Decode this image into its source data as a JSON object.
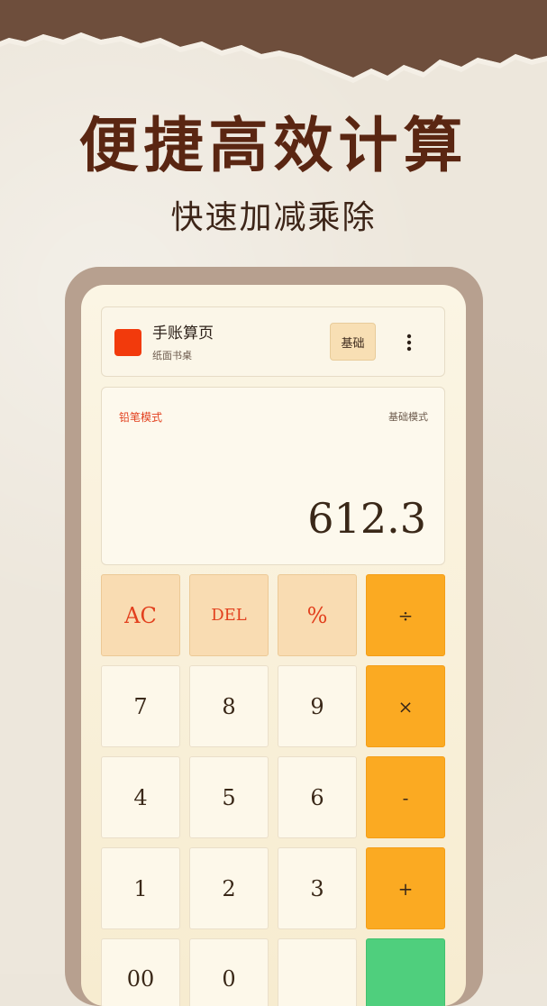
{
  "promo": {
    "headline": "便捷高效计算",
    "subheadline": "快速加减乘除"
  },
  "app": {
    "title": "手账算页",
    "subtitle": "纸面书桌",
    "mode_button": "基础",
    "more_icon": "more-vertical-icon",
    "logo_color": "#F23A0C"
  },
  "display": {
    "left_label": "铅笔模式",
    "right_label": "基础模式",
    "value": "612.3"
  },
  "keypad": {
    "rows": [
      [
        "AC",
        "DEL",
        "%",
        "÷"
      ],
      [
        "7",
        "8",
        "9",
        "×"
      ],
      [
        "4",
        "5",
        "6",
        "-"
      ],
      [
        "1",
        "2",
        "3",
        "+"
      ],
      [
        "00",
        "0",
        "",
        ""
      ]
    ]
  },
  "colors": {
    "accent_orange": "#FBAA22",
    "accent_red": "#E2401E",
    "equals_green": "#4FCF7D",
    "headline_brown": "#5A2612"
  }
}
